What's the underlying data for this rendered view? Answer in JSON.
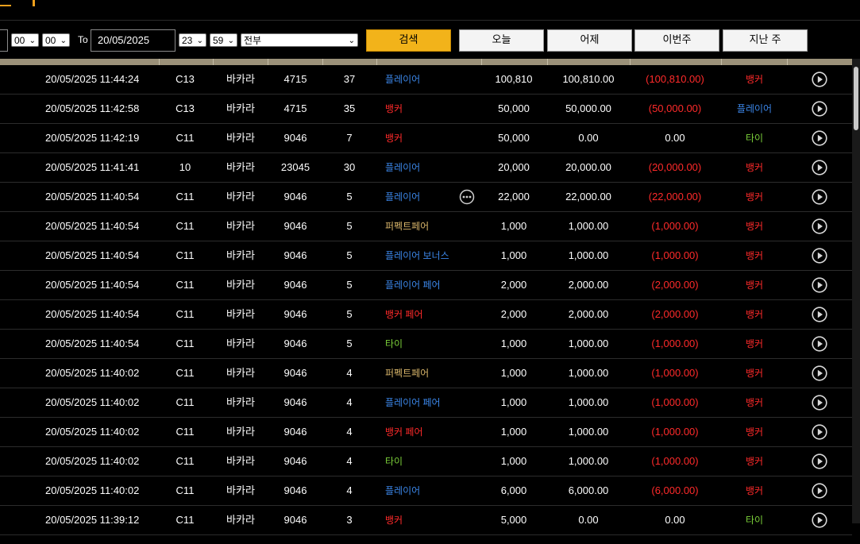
{
  "filters": {
    "from_min": "00",
    "from_sec": "00",
    "to_label": "To",
    "to_date": "20/05/2025",
    "to_hour": "23",
    "to_min": "59",
    "game_type": "전부",
    "search_label": "검색",
    "today_label": "오늘",
    "yesterday_label": "어제",
    "this_week_label": "이번주",
    "last_week_label": "지난 주"
  },
  "colors": {
    "accent": "#f2b31a",
    "banker_red": "#ff2a2a",
    "player_blue": "#3b86e8",
    "tie_green": "#7cd13a",
    "perfect_pair_tan": "#d8b56a"
  },
  "rows": [
    {
      "datetime": "20/05/2025 11:44:24",
      "table": "C13",
      "game": "바카라",
      "round": "4715",
      "num": "37",
      "bet": "플레이어",
      "bet_color": "blue",
      "stake": "100,810",
      "valid": "100,810.00",
      "winloss": "(100,810.00)",
      "winloss_color": "red",
      "result": "뱅커",
      "result_color": "red"
    },
    {
      "datetime": "20/05/2025 11:42:58",
      "table": "C13",
      "game": "바카라",
      "round": "4715",
      "num": "35",
      "bet": "뱅커",
      "bet_color": "red",
      "stake": "50,000",
      "valid": "50,000.00",
      "winloss": "(50,000.00)",
      "winloss_color": "red",
      "result": "플레이어",
      "result_color": "blue"
    },
    {
      "datetime": "20/05/2025 11:42:19",
      "table": "C11",
      "game": "바카라",
      "round": "9046",
      "num": "7",
      "bet": "뱅커",
      "bet_color": "red",
      "stake": "50,000",
      "valid": "0.00",
      "winloss": "0.00",
      "winloss_color": "white",
      "result": "타이",
      "result_color": "green"
    },
    {
      "datetime": "20/05/2025 11:41:41",
      "table": "10",
      "game": "바카라",
      "round": "23045",
      "num": "30",
      "bet": "플레이어",
      "bet_color": "blue",
      "stake": "20,000",
      "valid": "20,000.00",
      "winloss": "(20,000.00)",
      "winloss_color": "red",
      "result": "뱅커",
      "result_color": "red"
    },
    {
      "datetime": "20/05/2025 11:40:54",
      "table": "C11",
      "game": "바카라",
      "round": "9046",
      "num": "5",
      "bet": "플레이어",
      "bet_color": "blue",
      "stake": "22,000",
      "valid": "22,000.00",
      "winloss": "(22,000.00)",
      "winloss_color": "red",
      "result": "뱅커",
      "result_color": "red",
      "more_icon": "more-dots-icon"
    },
    {
      "datetime": "20/05/2025 11:40:54",
      "table": "C11",
      "game": "바카라",
      "round": "9046",
      "num": "5",
      "bet": "퍼펙트페어",
      "bet_color": "tan",
      "stake": "1,000",
      "valid": "1,000.00",
      "winloss": "(1,000.00)",
      "winloss_color": "red",
      "result": "뱅커",
      "result_color": "red"
    },
    {
      "datetime": "20/05/2025 11:40:54",
      "table": "C11",
      "game": "바카라",
      "round": "9046",
      "num": "5",
      "bet": "플레이어 보너스",
      "bet_color": "blue",
      "stake": "1,000",
      "valid": "1,000.00",
      "winloss": "(1,000.00)",
      "winloss_color": "red",
      "result": "뱅커",
      "result_color": "red"
    },
    {
      "datetime": "20/05/2025 11:40:54",
      "table": "C11",
      "game": "바카라",
      "round": "9046",
      "num": "5",
      "bet": "플레이어 페어",
      "bet_color": "blue",
      "stake": "2,000",
      "valid": "2,000.00",
      "winloss": "(2,000.00)",
      "winloss_color": "red",
      "result": "뱅커",
      "result_color": "red"
    },
    {
      "datetime": "20/05/2025 11:40:54",
      "table": "C11",
      "game": "바카라",
      "round": "9046",
      "num": "5",
      "bet": "뱅커 페어",
      "bet_color": "red",
      "stake": "2,000",
      "valid": "2,000.00",
      "winloss": "(2,000.00)",
      "winloss_color": "red",
      "result": "뱅커",
      "result_color": "red"
    },
    {
      "datetime": "20/05/2025 11:40:54",
      "table": "C11",
      "game": "바카라",
      "round": "9046",
      "num": "5",
      "bet": "타이",
      "bet_color": "green",
      "stake": "1,000",
      "valid": "1,000.00",
      "winloss": "(1,000.00)",
      "winloss_color": "red",
      "result": "뱅커",
      "result_color": "red"
    },
    {
      "datetime": "20/05/2025 11:40:02",
      "table": "C11",
      "game": "바카라",
      "round": "9046",
      "num": "4",
      "bet": "퍼펙트페어",
      "bet_color": "tan",
      "stake": "1,000",
      "valid": "1,000.00",
      "winloss": "(1,000.00)",
      "winloss_color": "red",
      "result": "뱅커",
      "result_color": "red"
    },
    {
      "datetime": "20/05/2025 11:40:02",
      "table": "C11",
      "game": "바카라",
      "round": "9046",
      "num": "4",
      "bet": "플레이어 페어",
      "bet_color": "blue",
      "stake": "1,000",
      "valid": "1,000.00",
      "winloss": "(1,000.00)",
      "winloss_color": "red",
      "result": "뱅커",
      "result_color": "red"
    },
    {
      "datetime": "20/05/2025 11:40:02",
      "table": "C11",
      "game": "바카라",
      "round": "9046",
      "num": "4",
      "bet": "뱅커 페어",
      "bet_color": "red",
      "stake": "1,000",
      "valid": "1,000.00",
      "winloss": "(1,000.00)",
      "winloss_color": "red",
      "result": "뱅커",
      "result_color": "red"
    },
    {
      "datetime": "20/05/2025 11:40:02",
      "table": "C11",
      "game": "바카라",
      "round": "9046",
      "num": "4",
      "bet": "타이",
      "bet_color": "green",
      "stake": "1,000",
      "valid": "1,000.00",
      "winloss": "(1,000.00)",
      "winloss_color": "red",
      "result": "뱅커",
      "result_color": "red"
    },
    {
      "datetime": "20/05/2025 11:40:02",
      "table": "C11",
      "game": "바카라",
      "round": "9046",
      "num": "4",
      "bet": "플레이어",
      "bet_color": "blue",
      "stake": "6,000",
      "valid": "6,000.00",
      "winloss": "(6,000.00)",
      "winloss_color": "red",
      "result": "뱅커",
      "result_color": "red"
    },
    {
      "datetime": "20/05/2025 11:39:12",
      "table": "C11",
      "game": "바카라",
      "round": "9046",
      "num": "3",
      "bet": "뱅커",
      "bet_color": "red",
      "stake": "5,000",
      "valid": "0.00",
      "winloss": "0.00",
      "winloss_color": "white",
      "result": "타이",
      "result_color": "green"
    }
  ]
}
